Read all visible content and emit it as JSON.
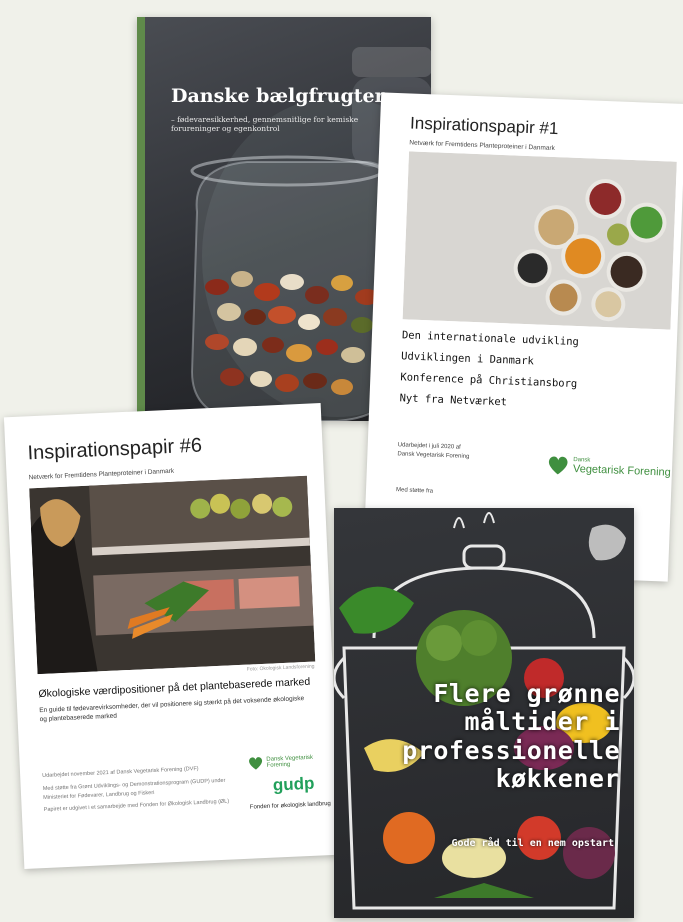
{
  "covers": {
    "baelgfrugter": {
      "title": "Danske bælgfrugter",
      "subtitle": "– fødevaresikkerhed, gennemsnitlige for kemiske forureninger og egenkontrol"
    },
    "papir1": {
      "title": "Inspirationspapir #1",
      "network": "Netværk for Fremtidens Planteproteiner i Danmark",
      "toc": [
        "Den internationale udvikling",
        "Udviklingen i Danmark",
        "Konference på Christiansborg",
        "Nyt fra Netværket"
      ],
      "published_line1": "Udarbejdet i juli 2020 af",
      "published_line2": "Dansk Vegetarisk Forening",
      "logo_small": "Dansk",
      "logo_big": "Vegetarisk Forening",
      "support": "Med støtte fra"
    },
    "papir6": {
      "title": "Inspirationspapir #6",
      "network": "Netværk for Fremtidens Planteproteiner i Danmark",
      "photo_credit": "Foto: Okologisk Landsforening",
      "heading": "Økologiske værdipositioner på det plantebaserede marked",
      "description": "En guide til fødevarevirksomheder, der vil positionere sig stærkt på det voksende økologiske og plantebaserede marked",
      "pub1": "Udarbejdet november 2021 af Dansk Vegetarisk Forening (DVF)",
      "pub2": "Med støtte fra Grønt Udviklings- og Demonstrationsprogram (GUDP) under Ministeriet for Fødevarer, Landbrug og Fiskeri",
      "pub3": "Papiret er udgivet i et samarbejde med Fonden for Økologisk Landbrug (ØL)",
      "logo_text": "Dansk Vegetarisk Forening",
      "gudp": "gudp",
      "organic": "Fonden for økologisk landbrug"
    },
    "flere": {
      "title_lines": [
        "Flere grønne",
        "måltider i",
        "professionelle",
        "køkkener"
      ],
      "tagline": "Gode råd til en nem opstart"
    }
  },
  "colors": {
    "green_accent": "#3f8f3f",
    "gudp_green": "#22a05b",
    "dark_cover": "#2b2c30"
  }
}
